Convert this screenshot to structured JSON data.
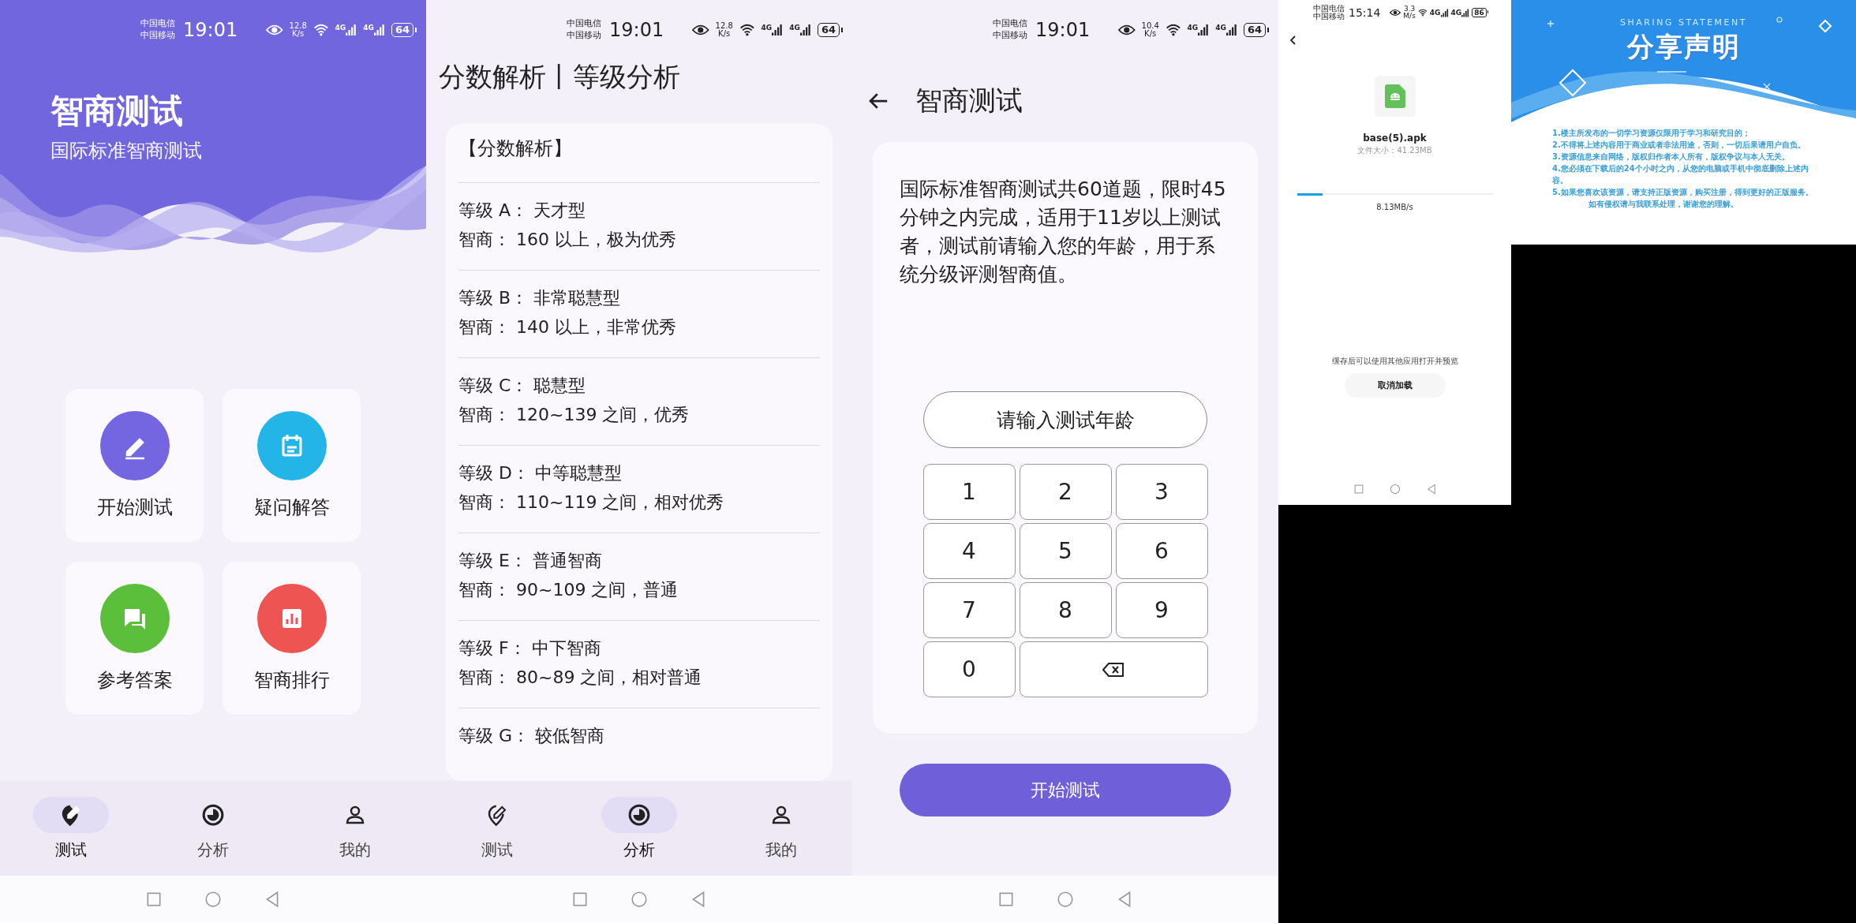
{
  "home": {
    "status": {
      "carriers": [
        "中国电信",
        "中国移动"
      ],
      "time": "19:01",
      "speed": "12.8",
      "speed_unit": "K/s",
      "networks": [
        "4G",
        "4G"
      ],
      "battery": "64"
    },
    "title": "智商测试",
    "subtitle": "国际标准智商测试",
    "tiles": [
      {
        "label": "开始测试",
        "color": "#7466e0"
      },
      {
        "label": "疑问解答",
        "color": "#23b5e8"
      },
      {
        "label": "参考答案",
        "color": "#5cbf3c"
      },
      {
        "label": "智商排行",
        "color": "#ee5552"
      }
    ],
    "nav": [
      {
        "label": "测试",
        "selected": true
      },
      {
        "label": "分析",
        "selected": false
      },
      {
        "label": "我的",
        "selected": false
      }
    ]
  },
  "analysis": {
    "status": {
      "carriers": [
        "中国电信",
        "中国移动"
      ],
      "time": "19:01",
      "speed": "12.8",
      "speed_unit": "K/s",
      "networks": [
        "4G",
        "4G"
      ],
      "battery": "64"
    },
    "title": "分数解析丨等级分析",
    "section": "【分数解析】",
    "grades": [
      {
        "grade": "等级 A：  天才型",
        "iq": "智商：  160 以上，极为优秀"
      },
      {
        "grade": "等级 B：  非常聪慧型",
        "iq": "智商：  140 以上，非常优秀"
      },
      {
        "grade": "等级 C：  聪慧型",
        "iq": "智商：  120~139 之间，优秀"
      },
      {
        "grade": "等级 D：  中等聪慧型",
        "iq": "智商：  110~119 之间，相对优秀"
      },
      {
        "grade": "等级 E：  普通智商",
        "iq": "智商：  90~109 之间，普通"
      },
      {
        "grade": "等级 F：  中下智商",
        "iq": "智商：  80~89 之间，相对普通"
      },
      {
        "grade": "等级 G：  较低智商"
      }
    ],
    "nav": [
      {
        "label": "测试",
        "selected": false
      },
      {
        "label": "分析",
        "selected": true
      },
      {
        "label": "我的",
        "selected": false
      }
    ]
  },
  "test": {
    "status": {
      "carriers": [
        "中国电信",
        "中国移动"
      ],
      "time": "19:01",
      "speed": "10.4",
      "speed_unit": "K/s",
      "networks": [
        "4G",
        "4G"
      ],
      "battery": "64"
    },
    "title": "智商测试",
    "intro": "国际标准智商测试共60道题，限时45分钟之内完成，适用于11岁以上测试者，测试前请输入您的年龄，用于系统分级评测智商值。",
    "age_field": {
      "placeholder": "请输入测试年龄"
    },
    "keys": [
      {
        "kind": "digit",
        "label": "1"
      },
      {
        "kind": "digit",
        "label": "2"
      },
      {
        "kind": "digit",
        "label": "3"
      },
      {
        "kind": "digit",
        "label": "4"
      },
      {
        "kind": "digit",
        "label": "5"
      },
      {
        "kind": "digit",
        "label": "6"
      },
      {
        "kind": "digit",
        "label": "7"
      },
      {
        "kind": "digit",
        "label": "8"
      },
      {
        "kind": "digit",
        "label": "9"
      },
      {
        "kind": "digit",
        "label": "0"
      },
      {
        "kind": "backspace"
      }
    ],
    "start_button": "开始测试"
  },
  "download": {
    "status": {
      "carriers": [
        "中国电信",
        "中国移动"
      ],
      "time": "15:14",
      "speed": "3.3",
      "speed_unit": "M/s",
      "networks": [
        "4G",
        "4G"
      ],
      "battery": "86"
    },
    "file_name": "base(5).apk",
    "file_size": "文件大小：41.23MB",
    "level": 0.13,
    "rate": "8.13MB/s",
    "hint": "缓存后可以使用其他应用打开并预览",
    "cancel_button": "取消加载"
  },
  "statement": {
    "subtitle": "SHARING STATEMENT",
    "title": "分享声明",
    "lines": [
      "1.楼主所发布的一切学习资源仅限用于学习和研究目的；",
      "2.不得将上述内容用于商业或者非法用途，否则，一切后果请用户自负。",
      "3.资源信息来自网络，版权归作者本人所有，版权争议与本人无关。",
      "4.您必须在下载后的24个小时之内，从您的电脑或手机中彻底删除上述内容。",
      "5.如果您喜欢该资源，请支持正版资源，购买注册，得到更好的正版服务。"
    ],
    "closing": "如有侵权请与我联系处理，谢谢您的理解。"
  }
}
